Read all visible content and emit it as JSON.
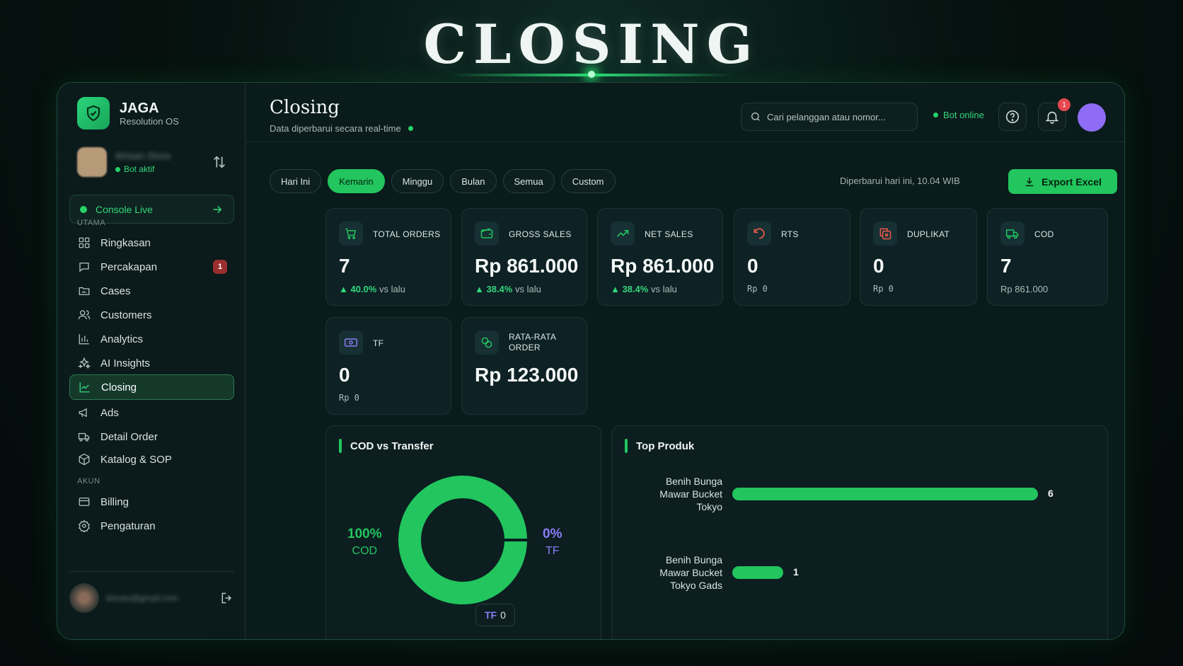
{
  "hero": {
    "title": "CLOSING"
  },
  "brand": {
    "name": "JAGA",
    "subtitle": "Resolution OS"
  },
  "profile": {
    "name": "Ikhsan Store",
    "status": "Bot aktif"
  },
  "console": {
    "label": "Console Live"
  },
  "sidebar": {
    "section_main": "UTAMA",
    "items": [
      {
        "label": "Ringkasan",
        "icon": "grid-icon"
      },
      {
        "label": "Percakapan",
        "icon": "chat-icon",
        "badge": "1"
      },
      {
        "label": "Cases",
        "icon": "folder-icon"
      },
      {
        "label": "Customers",
        "icon": "users-icon"
      },
      {
        "label": "Analytics",
        "icon": "bar-chart-icon"
      },
      {
        "label": "AI Insights",
        "icon": "sparkles-icon"
      },
      {
        "label": "Closing",
        "icon": "line-chart-icon",
        "active": true
      },
      {
        "label": "Ads",
        "icon": "megaphone-icon"
      },
      {
        "label": "Detail Order",
        "icon": "truck-icon"
      },
      {
        "label": "Katalog & SOP",
        "icon": "box-icon"
      }
    ],
    "section_account": "AKUN",
    "account_items": [
      {
        "label": "Billing",
        "icon": "card-icon"
      },
      {
        "label": "Pengaturan",
        "icon": "gear-icon"
      }
    ],
    "footer_email": "ikhsan@gmail.com"
  },
  "header": {
    "title": "Closing",
    "subtitle": "Data diperbarui secara real-time",
    "search_placeholder": "Cari pelanggan atau nomor...",
    "bot_status": "Bot online",
    "notification_count": "1"
  },
  "filters": {
    "options": [
      "Hari Ini",
      "Kemarin",
      "Minggu",
      "Bulan",
      "Semua",
      "Custom"
    ],
    "selected": "Kemarin",
    "updated": "Diperbarui hari ini, 10.04 WIB",
    "export_label": "Export Excel"
  },
  "cards": [
    {
      "label": "TOTAL ORDERS",
      "value": "7",
      "delta": "▲ 40.0%",
      "delta_suffix": "vs lalu",
      "icon": "cart-icon",
      "icon_color": "#22c55e"
    },
    {
      "label": "GROSS SALES",
      "value": "Rp 861.000",
      "delta": "▲ 38.4%",
      "delta_suffix": "vs lalu",
      "icon": "wallet-icon",
      "icon_color": "#22c55e"
    },
    {
      "label": "NET SALES",
      "value": "Rp 861.000",
      "delta": "▲ 38.4%",
      "delta_suffix": "vs lalu",
      "icon": "trend-up-icon",
      "icon_color": "#22c55e"
    },
    {
      "label": "RTS",
      "value": "0",
      "sub": "Rp 0",
      "icon": "undo-icon",
      "icon_color": "#ef5a4a"
    },
    {
      "label": "DUPLIKAT",
      "value": "0",
      "sub": "Rp 0",
      "icon": "copy-x-icon",
      "icon_color": "#ef5a4a"
    },
    {
      "label": "COD",
      "value": "7",
      "sub": "Rp 861.000",
      "icon": "truck-icon",
      "icon_color": "#22c55e"
    },
    {
      "label": "TF",
      "value": "0",
      "sub": "Rp 0",
      "icon": "money-icon",
      "icon_color": "#8b7cf6"
    },
    {
      "label": "RATA-RATA ORDER",
      "value": "Rp 123.000",
      "icon": "coins-icon",
      "icon_color": "#22c55e"
    }
  ],
  "cod_panel": {
    "title": "COD vs Transfer",
    "cod_pct": "100%",
    "cod_label": "COD",
    "tf_pct": "0%",
    "tf_label": "TF",
    "tf_pill_label": "TF",
    "tf_pill_value": "0"
  },
  "top_products": {
    "title": "Top Produk"
  },
  "colors": {
    "accent": "#22c55e",
    "tf": "#8b7cf6",
    "danger": "#ef5a4a"
  },
  "chart_data": [
    {
      "type": "pie",
      "title": "COD vs Transfer",
      "categories": [
        "COD",
        "TF"
      ],
      "values": [
        100,
        0
      ]
    },
    {
      "type": "bar",
      "title": "Top Produk",
      "categories": [
        "Benih Bunga Mawar Bucket Tokyo",
        "Benih Bunga Mawar Bucket Tokyo Gads"
      ],
      "values": [
        6,
        1
      ]
    }
  ]
}
